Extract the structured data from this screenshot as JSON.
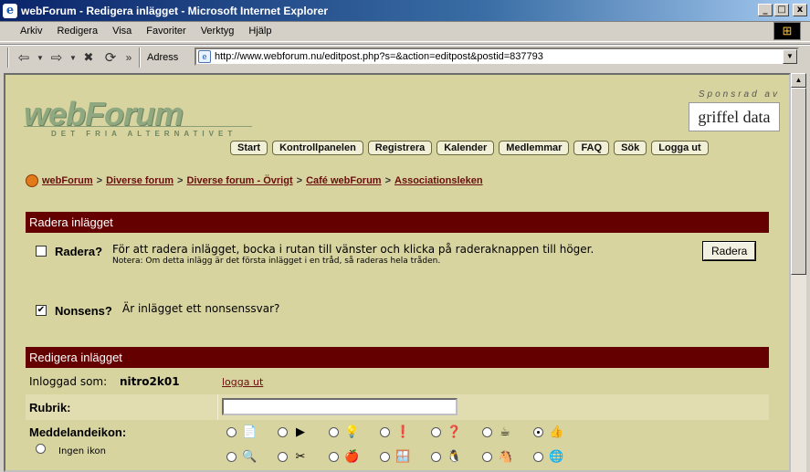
{
  "window": {
    "title": "webForum - Redigera inlägget - Microsoft Internet Explorer",
    "min": "_",
    "max": "□",
    "close": "x"
  },
  "menu": [
    "Arkiv",
    "Redigera",
    "Visa",
    "Favoriter",
    "Verktyg",
    "Hjälp"
  ],
  "toolbar": {
    "back": "⇦",
    "forward": "⇨",
    "stop": "✖",
    "refresh": "⟳",
    "more": "»",
    "address_label": "Adress",
    "url": "http://www.webforum.nu/editpost.php?s=&action=editpost&postid=837793"
  },
  "site": {
    "logo": "webForum",
    "tagline": "DET FRIA ALTERNATIVET",
    "sponsor_label": "Sponsrad av",
    "sponsor_name": "griffel data",
    "nav": [
      "Start",
      "Kontrollpanelen",
      "Registrera",
      "Kalender",
      "Medlemmar",
      "FAQ",
      "Sök",
      "Logga ut"
    ],
    "breadcrumb": [
      "webForum",
      "Diverse forum",
      "Diverse forum - Övrigt",
      "Café webForum",
      "Associationsleken"
    ],
    "breadcrumb_sep": ">"
  },
  "delete_section": {
    "title": "Radera inlägget",
    "label": "Radera?",
    "text": "För att radera inlägget, bocka i rutan till vänster och klicka på raderaknappen till höger.",
    "note": "Notera: Om detta inlägg är det första inlägget i en tråd, så raderas hela tråden.",
    "button": "Radera",
    "nonsense_label": "Nonsens?",
    "nonsense_text": "Är inlägget ett nonsenssvar?",
    "nonsense_checked_mark": "✔"
  },
  "edit_section": {
    "title": "Redigera inlägget",
    "logged_in_label": "Inloggad som:",
    "username": "nitro2k01",
    "logout_link": "logga ut",
    "subject_label": "Rubrik:",
    "subject_value": "",
    "icon_label": "Meddelandeikon:",
    "no_icon_label": "Ingen ikon",
    "icons_row1": [
      "📄",
      "▶",
      "💡",
      "❗",
      "❓",
      "☕",
      "👍"
    ],
    "icons_row2": [
      "🔍",
      "✂",
      "🍎",
      "🪟",
      "🐧",
      "🐴",
      "🌐"
    ],
    "selected_icon_index": 6
  }
}
